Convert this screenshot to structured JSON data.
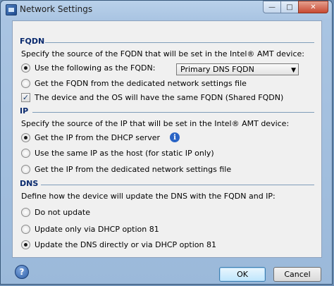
{
  "window": {
    "title": "Network Settings",
    "controls": {
      "minimize": "—",
      "maximize": "□",
      "close": "✕"
    }
  },
  "fqdn": {
    "title": "FQDN",
    "description": "Specify the source of the FQDN that will be set in the Intel® AMT device:",
    "option_use": "Use the following as the FQDN:",
    "option_use_selected": true,
    "select_value": "Primary DNS FQDN",
    "option_file": "Get the FQDN from the dedicated network settings file",
    "shared_checkbox": "The device and the OS will have the same FQDN (Shared FQDN)",
    "shared_checked": true
  },
  "ip": {
    "title": "IP",
    "description": "Specify the source of the IP that will be set in the Intel® AMT device:",
    "option_dhcp": "Get the IP from the DHCP server",
    "option_dhcp_selected": true,
    "option_same": "Use the same IP as the host (for static IP only)",
    "option_file": "Get the IP from the dedicated network settings file"
  },
  "dns": {
    "title": "DNS",
    "description": "Define how the device will update the DNS with the FQDN and IP:",
    "option_none": "Do not update",
    "option_dhcp81": "Update only via DHCP option 81",
    "option_direct": "Update the DNS directly or via DHCP option 81",
    "option_direct_selected": true
  },
  "footer": {
    "help_glyph": "?",
    "ok_label": "OK",
    "cancel_label": "Cancel"
  },
  "icons": {
    "info": "info-icon",
    "help": "help-icon",
    "dropdown": "chevron-down-icon"
  },
  "colors": {
    "section_title": "#0a2a6e",
    "info_blue": "#2a64c5"
  }
}
